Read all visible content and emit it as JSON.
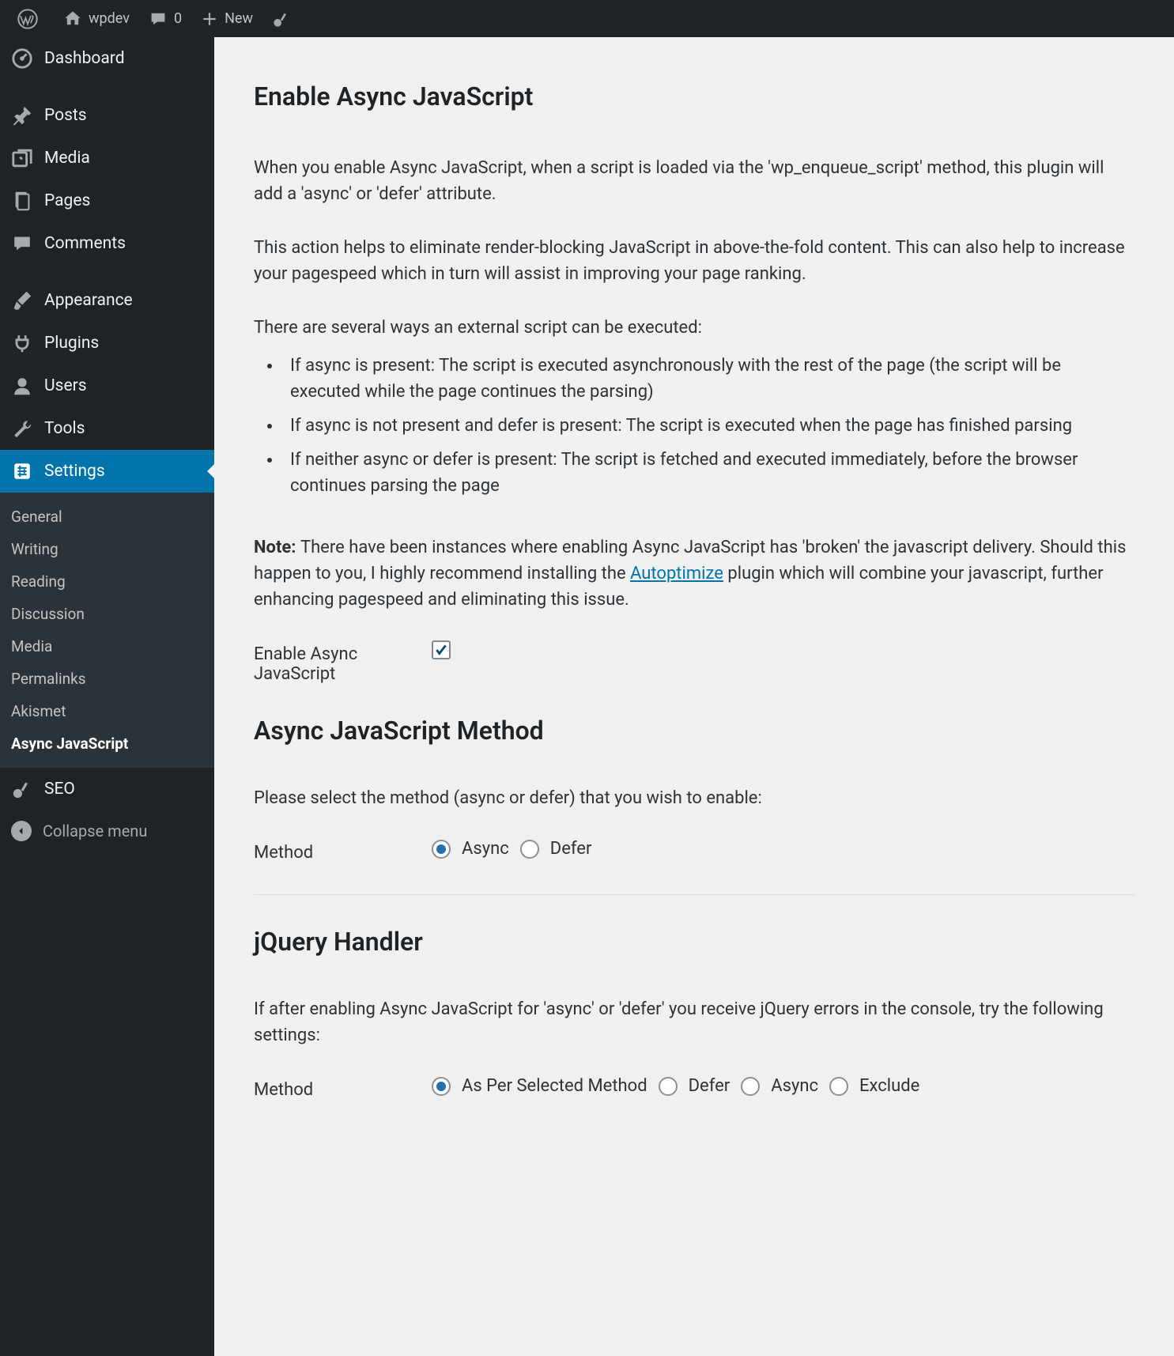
{
  "adminbar": {
    "site_name": "wpdev",
    "comments_count": "0",
    "new_label": "New"
  },
  "sidebar": {
    "items": [
      {
        "label": "Dashboard"
      },
      {
        "label": "Posts"
      },
      {
        "label": "Media"
      },
      {
        "label": "Pages"
      },
      {
        "label": "Comments"
      },
      {
        "label": "Appearance"
      },
      {
        "label": "Plugins"
      },
      {
        "label": "Users"
      },
      {
        "label": "Tools"
      },
      {
        "label": "Settings"
      },
      {
        "label": "SEO"
      }
    ],
    "submenu": [
      {
        "label": "General"
      },
      {
        "label": "Writing"
      },
      {
        "label": "Reading"
      },
      {
        "label": "Discussion"
      },
      {
        "label": "Media"
      },
      {
        "label": "Permalinks"
      },
      {
        "label": "Akismet"
      },
      {
        "label": "Async JavaScript"
      }
    ],
    "collapse": "Collapse menu"
  },
  "content": {
    "h1": "Enable Async JavaScript",
    "p1": "When you enable Async JavaScript, when a script is loaded via the 'wp_enqueue_script' method, this plugin will add a 'async' or 'defer' attribute.",
    "p2": "This action helps to eliminate render-blocking JavaScript in above-the-fold content. This can also help to increase your pagespeed which in turn will assist in improving your page ranking.",
    "p3": "There are several ways an external script can be executed:",
    "li1": "If async is present: The script is executed asynchronously with the rest of the page (the script will be executed while the page continues the parsing)",
    "li2": "If async is not present and defer is present: The script is executed when the page has finished parsing",
    "li3": "If neither async or defer is present: The script is fetched and executed immediately, before the browser continues parsing the page",
    "note_label": "Note: ",
    "note_a": "There have been instances where enabling Async JavaScript has 'broken' the javascript delivery. Should this happen to you, I highly recommend installing the ",
    "note_link": "Autoptimize",
    "note_b": " plugin which will combine your javascript, further enhancing pagespeed and eliminating this issue.",
    "enable_label": "Enable Async JavaScript",
    "h2": "Async JavaScript Method",
    "p4": "Please select the method (async or defer) that you wish to enable:",
    "method_label": "Method",
    "opt_async": "Async",
    "opt_defer": "Defer",
    "h3": "jQuery Handler",
    "p5": "If after enabling Async JavaScript for 'async' or 'defer' you receive jQuery errors in the console, try the following settings:",
    "jq_method_label": "Method",
    "jq_opt1": "As Per Selected Method",
    "jq_opt2": "Defer",
    "jq_opt3": "Async",
    "jq_opt4": "Exclude"
  }
}
